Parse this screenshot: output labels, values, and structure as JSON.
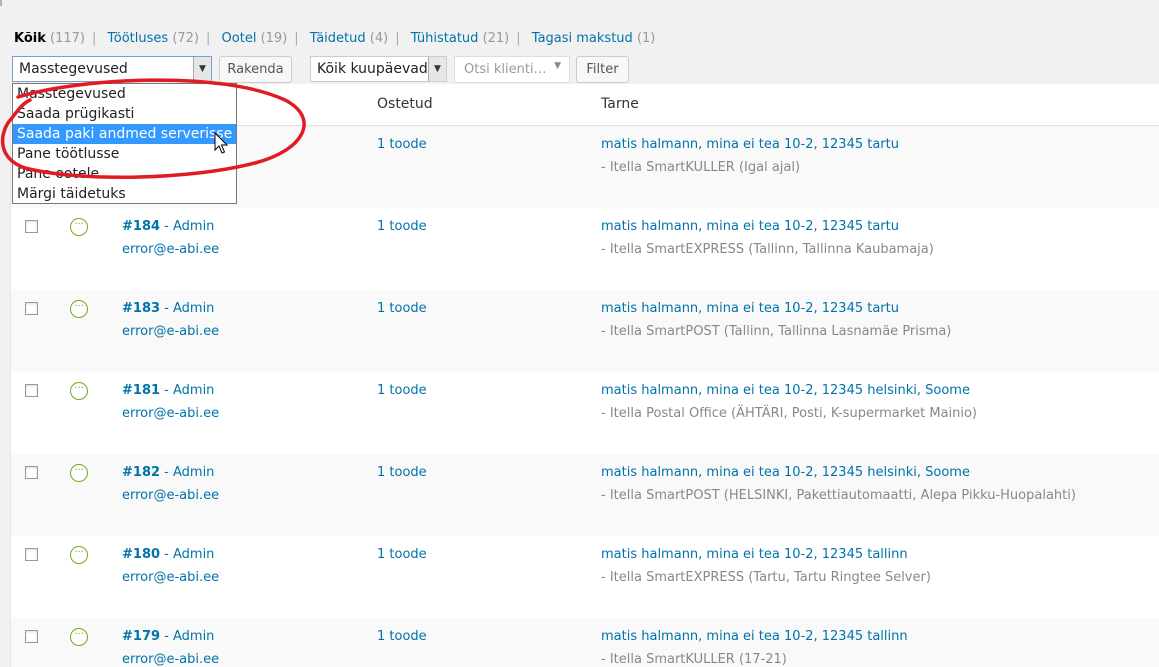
{
  "filters": [
    {
      "label": "Kõik",
      "count": "(117)",
      "current": true
    },
    {
      "label": "Töötluses",
      "count": "(72)"
    },
    {
      "label": "Ootel",
      "count": "(19)"
    },
    {
      "label": "Täidetud",
      "count": "(4)"
    },
    {
      "label": "Tühistatud",
      "count": "(21)"
    },
    {
      "label": "Tagasi makstud",
      "count": "(1)"
    }
  ],
  "filter_separator": "|",
  "toolbar": {
    "bulk_selected": "Masstegevused",
    "apply_label": "Rakenda",
    "date_selected": "Kõik kuupäevad",
    "customer_placeholder": "Otsi klienti…",
    "filter_label": "Filter",
    "arrow_glyph": "▼"
  },
  "bulk_options": [
    "Masstegevused",
    "Saada prügikasti",
    "Saada paki andmed serverisse",
    "Pane töötlusse",
    "Pane ootele",
    "Märgi täidetuks"
  ],
  "highlighted_option": "Saada paki andmed serverisse",
  "columns": {
    "purchased": "Ostetud",
    "shipping": "Tarne"
  },
  "status_glyph": "···",
  "colors": {
    "link": "#0073aa",
    "status_processing": "#73a724",
    "highlight": "#3399ff",
    "annotation": "#e01b24"
  },
  "first_row": {
    "items": "1 toode",
    "address": "matis halmann, mina ei tea 10-2, 12345 tartu",
    "method": "- Itella SmartKULLER (Igal ajal)"
  },
  "orders": [
    {
      "num": "#184",
      "by": " - Admin",
      "email": "error@e-abi.ee",
      "items": "1 toode",
      "address": "matis halmann, mina ei tea 10-2, 12345 tartu",
      "method": "- Itella SmartEXPRESS (Tallinn, Tallinna Kaubamaja)"
    },
    {
      "num": "#183",
      "by": " - Admin",
      "email": "error@e-abi.ee",
      "items": "1 toode",
      "address": "matis halmann, mina ei tea 10-2, 12345 tartu",
      "method": "- Itella SmartPOST (Tallinn, Tallinna Lasnamäe Prisma)"
    },
    {
      "num": "#181",
      "by": " - Admin",
      "email": "error@e-abi.ee",
      "items": "1 toode",
      "address": "matis halmann, mina ei tea 10-2, 12345 helsinki, Soome",
      "method": "- Itella Postal Office (ÄHTÄRI, Posti, K-supermarket Mainio)"
    },
    {
      "num": "#182",
      "by": " - Admin",
      "email": "error@e-abi.ee",
      "items": "1 toode",
      "address": "matis halmann, mina ei tea 10-2, 12345 helsinki, Soome",
      "method": "- Itella SmartPOST (HELSINKI, Pakettiautomaatti, Alepa Pikku-Huopalahti)"
    },
    {
      "num": "#180",
      "by": " - Admin",
      "email": "error@e-abi.ee",
      "items": "1 toode",
      "address": "matis halmann, mina ei tea 10-2, 12345 tallinn",
      "method": "- Itella SmartEXPRESS (Tartu, Tartu Ringtee Selver)"
    },
    {
      "num": "#179",
      "by": " - Admin",
      "email": "error@e-abi.ee",
      "items": "1 toode",
      "address": "matis halmann, mina ei tea 10-2, 12345 tallinn",
      "method": "- Itella SmartKULLER (17-21)"
    }
  ]
}
